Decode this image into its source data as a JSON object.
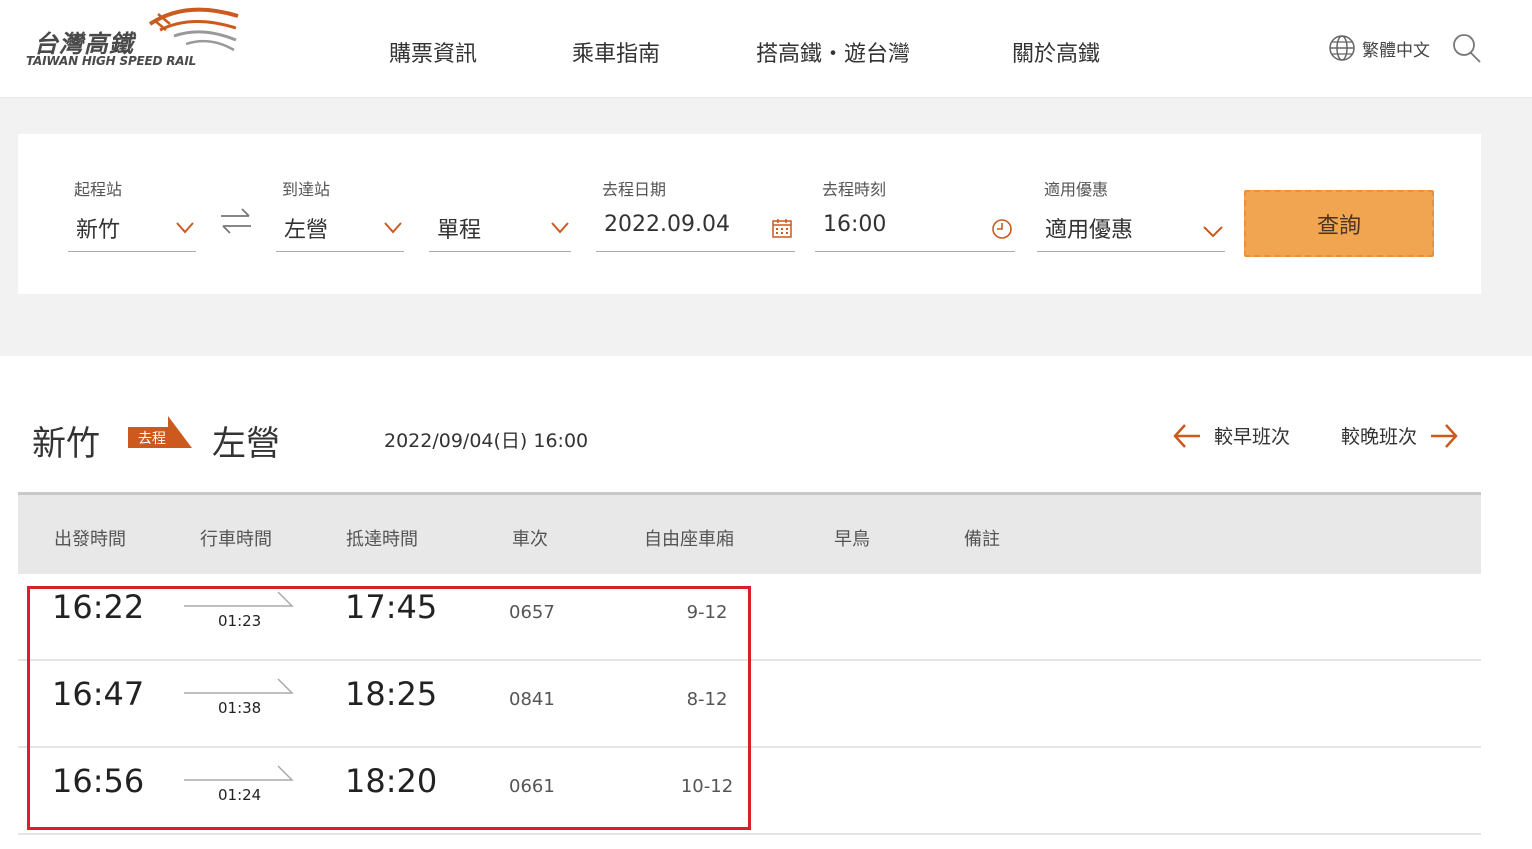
{
  "brand": {
    "name_cn": "台灣高鐵",
    "name_en": "TAIWAN HIGH SPEED RAIL",
    "accent": "#cc5a1e"
  },
  "nav": {
    "items": [
      "購票資訊",
      "乘車指南",
      "搭高鐵・遊台灣",
      "關於高鐵"
    ]
  },
  "lang": {
    "label": "繁體中文"
  },
  "search": {
    "origin": {
      "label": "起程站",
      "value": "新竹"
    },
    "destination": {
      "label": "到達站",
      "value": "左營"
    },
    "trip_type": {
      "value": "單程"
    },
    "date": {
      "label": "去程日期",
      "value": "2022.09.04"
    },
    "time": {
      "label": "去程時刻",
      "value": "16:00"
    },
    "discount": {
      "label": "適用優惠",
      "value": "適用優惠"
    },
    "query_label": "查詢"
  },
  "route": {
    "from": "新竹",
    "badge": "去程",
    "to": "左營",
    "datetime": "2022/09/04(日) 16:00",
    "earlier": "較早班次",
    "later": "較晚班次"
  },
  "table": {
    "headers": [
      "出發時間",
      "行車時間",
      "抵達時間",
      "車次",
      "自由座車廂",
      "早鳥",
      "備註"
    ],
    "rows": [
      {
        "dep": "16:22",
        "dur": "01:23",
        "arr": "17:45",
        "train": "0657",
        "cars": "9-12"
      },
      {
        "dep": "16:47",
        "dur": "01:38",
        "arr": "18:25",
        "train": "0841",
        "cars": "8-12"
      },
      {
        "dep": "16:56",
        "dur": "01:24",
        "arr": "18:20",
        "train": "0661",
        "cars": "10-12"
      }
    ]
  },
  "colors": {
    "accent": "#cc5a1e",
    "button": "#f2a550",
    "highlight": "#d6202c",
    "band": "#f2f2f2"
  }
}
